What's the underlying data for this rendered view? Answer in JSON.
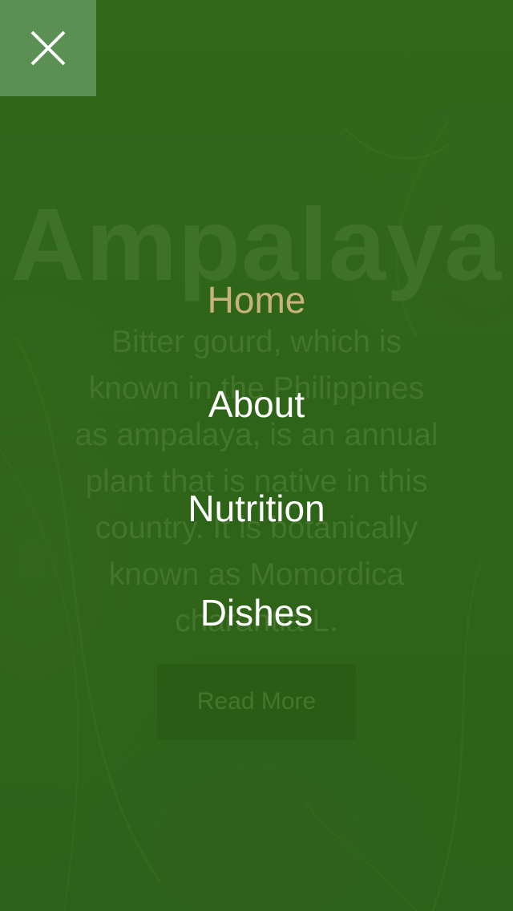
{
  "hero": {
    "title": "Ampalaya",
    "description": "Bitter gourd, which is known in the Philippines as ampalaya, is an annual plant that is native in this country. It is botanically known as Momordica charantia L.",
    "read_more_label": "Read More"
  },
  "menu": {
    "close_icon": "close-icon",
    "items": [
      {
        "label": "Home",
        "active": true
      },
      {
        "label": "About",
        "active": false
      },
      {
        "label": "Nutrition",
        "active": false
      },
      {
        "label": "Dishes",
        "active": false
      }
    ]
  },
  "colors": {
    "background": "#2f5e1a",
    "active_item": "#c7b37a",
    "close_button_bg": "#5a9054",
    "menu_text": "#ffffff"
  }
}
